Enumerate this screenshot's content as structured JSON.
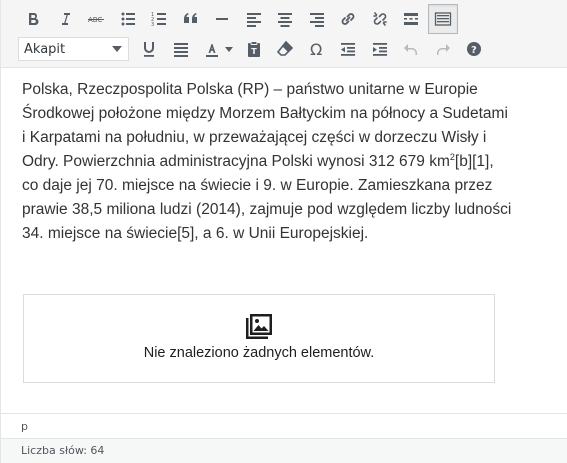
{
  "toolbar": {
    "format_select": {
      "value": "Akapit"
    }
  },
  "content": {
    "paragraph": "Polska, Rzeczpospolita Polska (RP) – państwo unitarne w Europie Środkowej położone między Morzem Bałtyckim na północy a Sudetami i Karpatami na południu, w przeważającej części w dorzeczu Wisły i Odry. Powierzchnia administracyjna Polski wynosi 312 679 km",
    "superscript": "2",
    "paragraph_cont": "[b][1], co daje jej 70. miejsce na świecie i 9. w Europie. Zamieszkana przez prawie 38,5 miliona ludzi (2014), zajmuje pod względem liczby ludności 34. miejsce na świecie[5], a 6. w Unii Europejskiej."
  },
  "gallery": {
    "message": "Nie znaleziono żadnych elementów."
  },
  "status": {
    "path": "p"
  },
  "footer": {
    "word_count": "Liczba słów: 64"
  },
  "colors": {
    "icon": "#555d66",
    "icon_disabled": "#b6babe",
    "toolbar_bg": "#f5f5f5"
  }
}
